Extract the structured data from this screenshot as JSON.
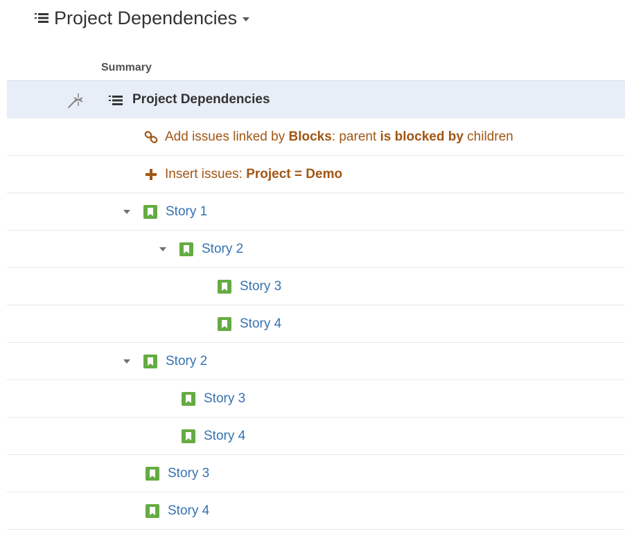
{
  "header": {
    "title": "Project Dependencies",
    "icon": "structure-icon"
  },
  "columns": {
    "summary": "Summary"
  },
  "root": {
    "label": "Project Dependencies",
    "icon": "structure-icon"
  },
  "generators": {
    "link": {
      "icon": "link-icon",
      "prefix": "Add issues linked by ",
      "link_type": "Blocks",
      "middle": ": parent ",
      "relation": "is blocked by",
      "suffix": " children"
    },
    "insert": {
      "icon": "plus-icon",
      "prefix": "Insert issues: ",
      "query": "Project = Demo"
    }
  },
  "rows": [
    {
      "label": "Story 1",
      "depth": 1,
      "expandable": true
    },
    {
      "label": "Story 2",
      "depth": 2,
      "expandable": true
    },
    {
      "label": "Story 3",
      "depth": 3,
      "expandable": false
    },
    {
      "label": "Story 4",
      "depth": 3,
      "expandable": false
    },
    {
      "label": "Story 2",
      "depth": 1,
      "expandable": true
    },
    {
      "label": "Story 3",
      "depth": 2,
      "expandable": false
    },
    {
      "label": "Story 4",
      "depth": 2,
      "expandable": false
    },
    {
      "label": "Story 3",
      "depth": 1,
      "expandable": false
    },
    {
      "label": "Story 4",
      "depth": 1,
      "expandable": false
    }
  ],
  "colors": {
    "story_icon": "#65ab43",
    "link_text": "#3572b0",
    "generator_text": "#a15513",
    "root_bg": "#e8eef8"
  }
}
